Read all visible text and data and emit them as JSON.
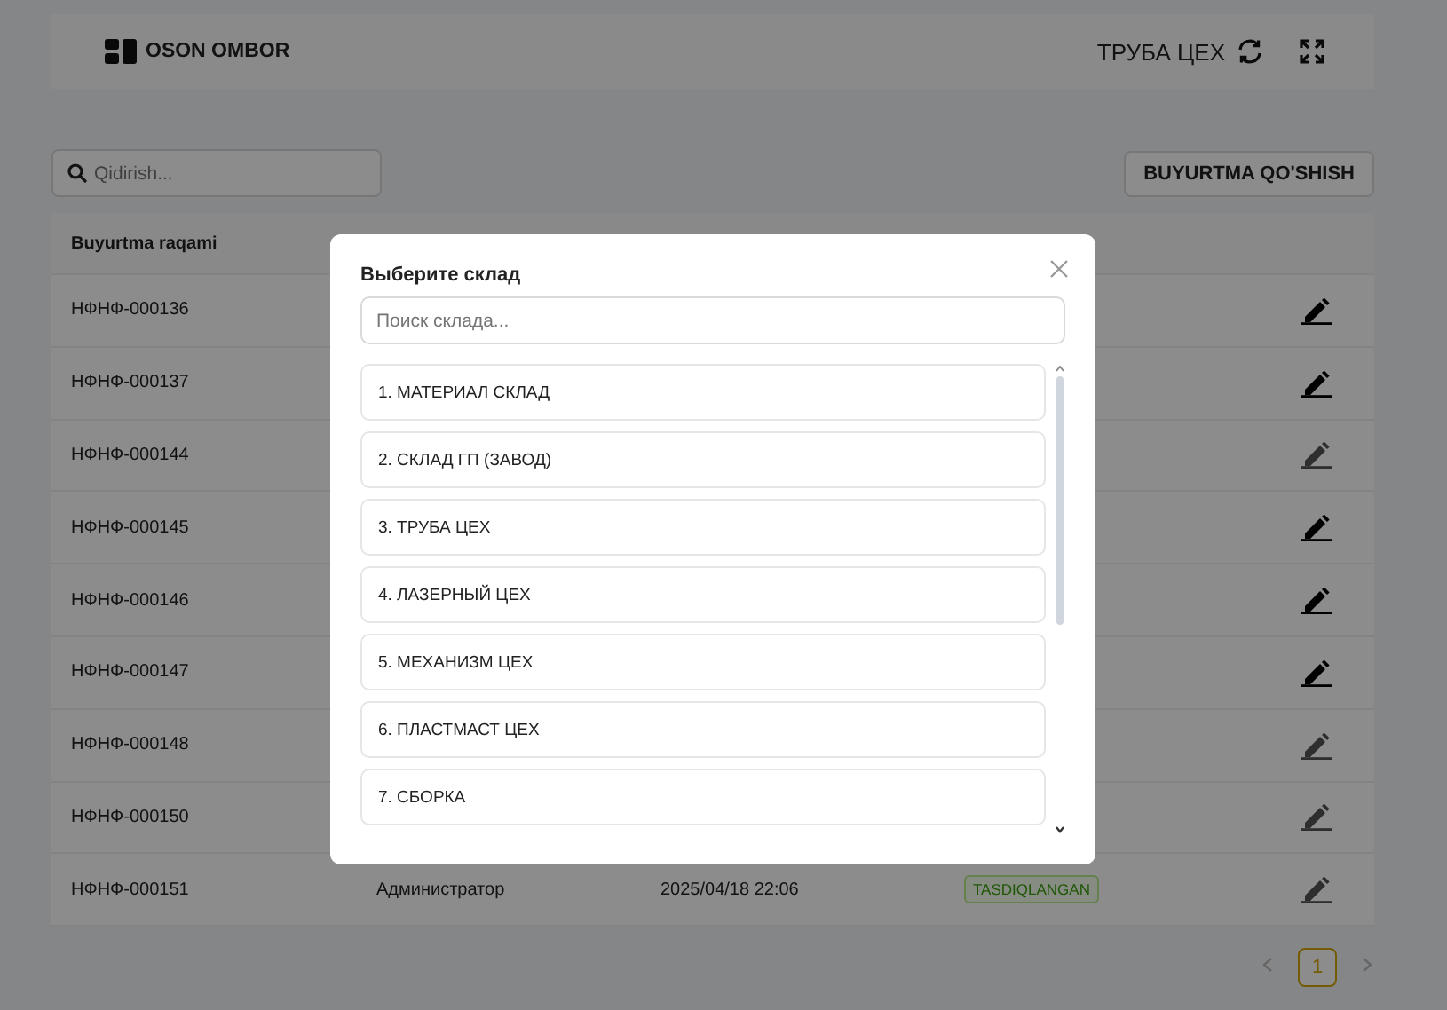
{
  "header": {
    "brand": "OSON OMBOR",
    "warehouse": "ТРУБА ЦЕХ"
  },
  "search": {
    "placeholder": "Qidirish..."
  },
  "add_button": "BUYURTMA QO'SHISH",
  "table": {
    "columns": [
      "Buyurtma raqami"
    ],
    "rows": [
      {
        "number": "НФНФ-000136",
        "edit_disabled": false
      },
      {
        "number": "НФНФ-000137",
        "edit_disabled": false
      },
      {
        "number": "НФНФ-000144",
        "edit_disabled": true
      },
      {
        "number": "НФНФ-000145",
        "edit_disabled": false
      },
      {
        "number": "НФНФ-000146",
        "edit_disabled": false
      },
      {
        "number": "НФНФ-000147",
        "edit_disabled": false
      },
      {
        "number": "НФНФ-000148",
        "edit_disabled": true
      },
      {
        "number": "НФНФ-000150",
        "edit_disabled": true
      },
      {
        "number": "НФНФ-000151",
        "author": "Администратор",
        "date": "2025/04/18 22:06",
        "status": "TASDIQLANGAN",
        "edit_disabled": true
      }
    ]
  },
  "pagination": {
    "pages": [
      {
        "label": "1",
        "selected": true
      }
    ]
  },
  "modal": {
    "title": "Выберите склад",
    "search_placeholder": "Поиск склада...",
    "items": [
      "1. МАТЕРИАЛ СКЛАД",
      "2. СКЛАД ГП (ЗАВОД)",
      "3. ТРУБА ЦЕХ",
      "4. ЛАЗЕРНЫЙ ЦЕХ",
      "5. МЕХАНИЗМ ЦЕХ",
      "6. ПЛАСТМАСТ ЦЕХ",
      "7. СБОРКА"
    ]
  }
}
